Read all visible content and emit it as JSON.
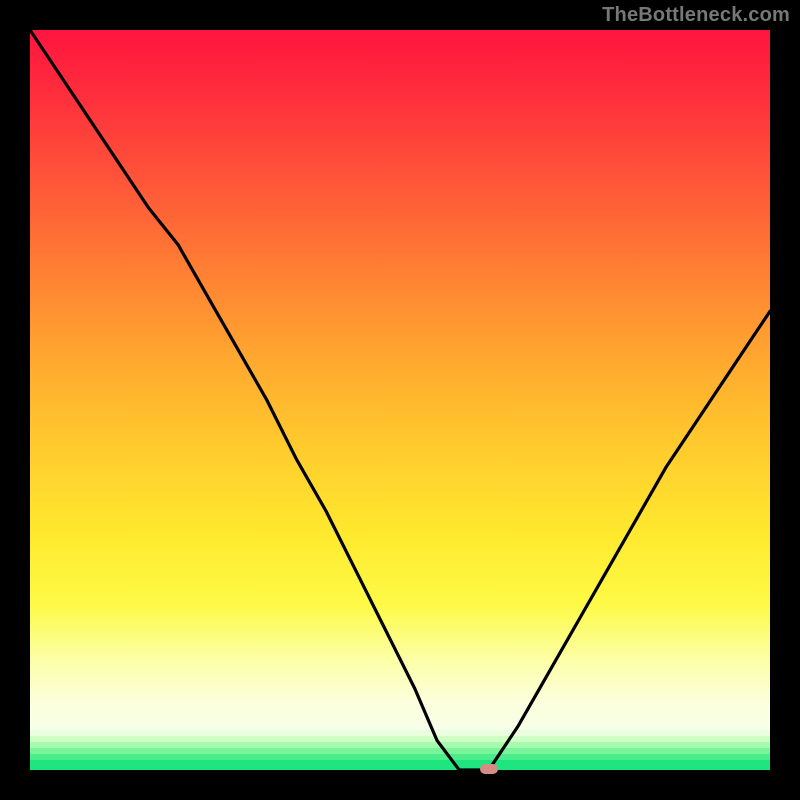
{
  "watermark": "TheBottleneck.com",
  "colors": {
    "frame": "#000000",
    "watermark": "#777777",
    "curve": "#000000",
    "marker": "#d68b84",
    "baseline_green": "#1ee57f",
    "gradient_top": "#ff153f",
    "gradient_bottom": "#f6ffe8"
  },
  "chart_data": {
    "type": "line",
    "title": "",
    "xlabel": "",
    "ylabel": "",
    "xlim": [
      0,
      100
    ],
    "ylim": [
      0,
      100
    ],
    "grid": false,
    "legend": false,
    "series": [
      {
        "name": "bottleneck-curve",
        "x": [
          0,
          4,
          8,
          12,
          16,
          20,
          24,
          28,
          32,
          36,
          40,
          44,
          48,
          52,
          55,
          58,
          60,
          62,
          66,
          70,
          74,
          78,
          82,
          86,
          90,
          94,
          98,
          100
        ],
        "y": [
          100,
          94,
          88,
          82,
          76,
          71,
          64,
          57,
          50,
          42,
          35,
          27,
          19,
          11,
          4,
          0,
          0,
          0,
          6,
          13,
          20,
          27,
          34,
          41,
          47,
          53,
          59,
          62
        ]
      }
    ],
    "marker": {
      "x": 62,
      "y": 0
    },
    "baseline": {
      "y": 0,
      "color": "#1ee57f"
    },
    "background_gradient": {
      "stops": [
        {
          "pos": 0.0,
          "color": "#ff153f"
        },
        {
          "pos": 0.5,
          "color": "#ffab2f"
        },
        {
          "pos": 0.8,
          "color": "#fdfa46"
        },
        {
          "pos": 0.94,
          "color": "#fcffdc"
        },
        {
          "pos": 0.955,
          "color": "#c9ffbe"
        },
        {
          "pos": 0.97,
          "color": "#8cf7a6"
        },
        {
          "pos": 0.985,
          "color": "#4bed8e"
        },
        {
          "pos": 1.0,
          "color": "#1ee57f"
        }
      ]
    }
  }
}
